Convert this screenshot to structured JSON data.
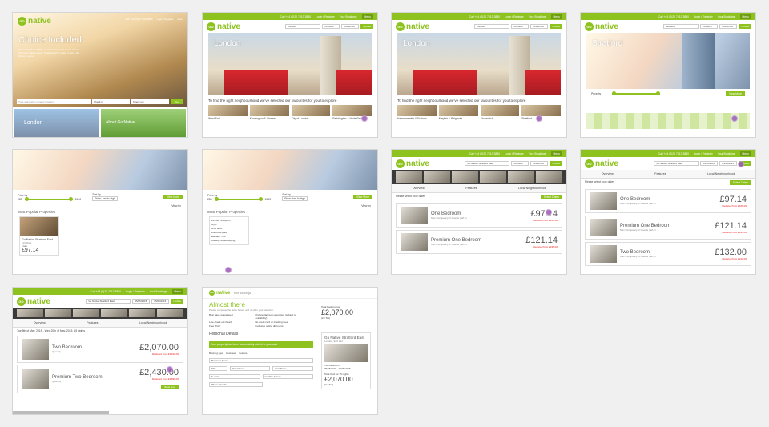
{
  "topbar": {
    "phone": "Call +44 (0)20 7013 3880",
    "auth": "Login / Register",
    "bookings": "Your Bookings",
    "menu": "Menu"
  },
  "brand": {
    "go": "GO",
    "name": "native"
  },
  "search": {
    "location_london": "London",
    "location_stratford": "Stratford",
    "location_property": "Go Native Stratford East",
    "checkin": "Check in",
    "checkout": "Check out",
    "update": "Update",
    "go_button": "Go",
    "placeholder": "Type a property name or location...",
    "date_in": "05/05/2015",
    "date_out": "05/05/2015"
  },
  "home": {
    "title": "Choice Included",
    "body": "Stay in any of our 1,500+ serviced apartments across 7 cities. From one night to a year. 8 Ireland dish - 1 week, 3 rent – the choice is yours.",
    "tile_london": "London",
    "tile_about": "About Go Native"
  },
  "city": {
    "london_title": "London",
    "stratford_title": "Stratford",
    "caption": "To find the right neighbourhood we've selected our favourites for you to explore",
    "view_more": "View More",
    "neighbourhoods_a": [
      "West End",
      "Kensington & Chelsea",
      "City of London",
      "Paddington & Hyde Park"
    ],
    "neighbourhoods_b": [
      "Hammersmith & Fulham",
      "Mayfair & Belgravia",
      "Shoreditch",
      "Stratford"
    ]
  },
  "filters": {
    "price_label": "Price by",
    "price_min": "£85",
    "price_max": "£100",
    "sort_label": "Sort by",
    "sort_value": "Price: low to high",
    "popular_heading": "Most Popular Properties",
    "view_by": "View by",
    "property_name": "Go Native Stratford East",
    "property_units": "113 Flats",
    "property_from": "From",
    "property_price": "£97.14",
    "amenities": [
      "24-hour reception",
      "Gym",
      "iPod dock",
      "Welcome pack",
      "Elevator / Lift",
      "Weekly housekeeping"
    ]
  },
  "property": {
    "tabs": [
      "Overview",
      "Features",
      "Local Neighbourhood"
    ],
    "select_dates": "Please select your dates",
    "select_dates_btn": "Select Dates",
    "more_details": "More details",
    "rooms": [
      {
        "name": "One Bedroom",
        "sub": "Max Occupancy: 2 Guests | Wi-Fi",
        "price": "£97.14",
        "reduced": "Reduced from £166.00"
      },
      {
        "name": "Premium One Bedroom",
        "sub": "Max Occupancy: 2 Guests | Wi-Fi",
        "price": "£121.14",
        "reduced": "Reduced from £195.00"
      },
      {
        "name": "Two Bedroom",
        "sub": "Max Occupancy: 4 Guests | Wi-Fi",
        "price": "£132.00",
        "reduced": "Reduced from £210.00"
      }
    ],
    "stay_dates": "Tue 5th of May, 2015 - Wed 20th of May, 2015, 15 nights",
    "stay_rooms": [
      {
        "name": "Two Bedroom",
        "price": "£2,070.00",
        "reduced": "Reduced from £3,190.00"
      },
      {
        "name": "Premium Two Bedroom",
        "price": "£2,430.00",
        "reduced": "Reduced from £3,690.00"
      }
    ],
    "quantity": "Quantity",
    "book_now": "Book Now"
  },
  "checkout": {
    "your_bookings": "Your Bookings",
    "title": "Almost there",
    "intro": "Please complete the fields below, and confirm your selection.",
    "bullets": [
      "Best rates guaranteed",
      "Preferential room allocation (subject to availability)",
      "Late check out if early",
      "No credit card on booking fees",
      "Free Wi-Fi",
      "Exclusive online discounts"
    ],
    "personal_details": "Personal Details",
    "success": "Your property has been successfully added to your cart.",
    "booking_type": "Booking type",
    "business": "Business",
    "leisure": "Leisure",
    "fields": [
      "Business Name",
      "Title",
      "First Name",
      "Last Name",
      "E-mail",
      "Confirm E-mail",
      "Phone Number"
    ],
    "total_label": "Total booking cost",
    "total": "£2,070.00",
    "total_note": "(inc Tax)",
    "card_title": "Go Native Stratford East",
    "card_city": "London, E20 1EJ",
    "card_room": "Two Bedroom",
    "card_dates": "05/05/2015 - 20/05/2015",
    "card_total_label": "Total Cost for 15 nights",
    "card_total": "£2,070.00",
    "card_total_note": "(inc Tax)"
  }
}
